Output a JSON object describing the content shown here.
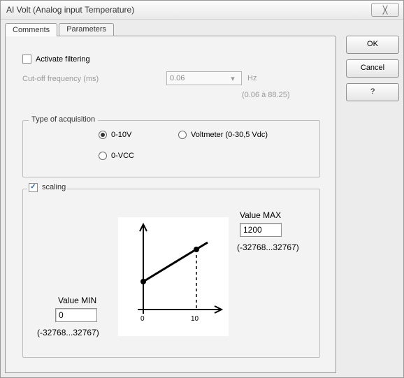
{
  "window": {
    "title": "AI Volt (Analog input Temperature)",
    "close_glyph": "╳"
  },
  "buttons": {
    "ok": "OK",
    "cancel": "Cancel",
    "help": "?"
  },
  "tabs": {
    "comments": "Comments",
    "parameters": "Parameters"
  },
  "filtering": {
    "checkbox_label": "Activate filtering",
    "checked": "",
    "cutoff_label": "Cut-off frequency (ms)",
    "cutoff_value": "0.06",
    "cutoff_unit": "Hz",
    "cutoff_range": "(0.06 à 88.25)"
  },
  "acquisition": {
    "legend": "Type of acquisition",
    "opt_0_10v": "0-10V",
    "opt_voltmeter": "Voltmeter (0-30,5 Vdc)",
    "opt_0_vcc": "0-VCC"
  },
  "scaling": {
    "checkbox_label": "scaling",
    "checked_glyph": "✓",
    "value_min_label": "Value MIN",
    "value_min": "0",
    "value_min_range": "(-32768...32767)",
    "value_max_label": "Value MAX",
    "value_max": "1200",
    "value_max_range": "(-32768...32767)",
    "axis_0": "0",
    "axis_10": "10"
  }
}
